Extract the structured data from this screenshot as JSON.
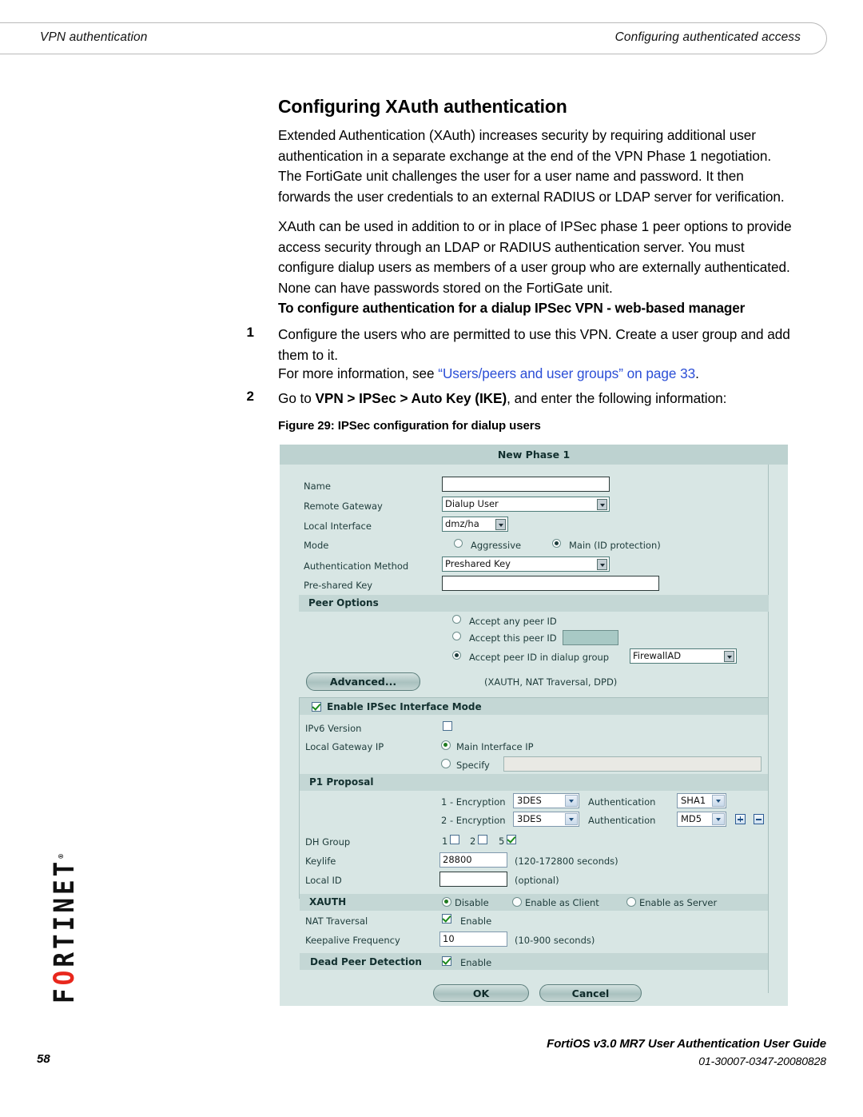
{
  "running_header": {
    "left": "VPN authentication",
    "right": "Configuring authenticated access"
  },
  "content": {
    "heading": "Configuring XAuth authentication",
    "paragraph_1": "Extended Authentication (XAuth) increases security by requiring additional user authentication in a separate exchange at the end of the VPN Phase 1 negotiation. The FortiGate unit challenges the user for a user name and password. It then forwards the user credentials to an external RADIUS or LDAP server for verification.",
    "paragraph_2": "XAuth can be used in addition to or in place of IPSec phase 1 peer options to provide access security through an LDAP or RADIUS authentication server. You must configure dialup users as members of a user group who are externally authenticated. None can have passwords stored on the FortiGate unit.",
    "subheading": "To configure authentication for a dialup IPSec VPN - web-based manager",
    "step_1_number": "1",
    "step_1_text": "Configure the users who are permitted to use this VPN. Create a user group and add them to it.",
    "crossref_prefix": "For more information, see ",
    "crossref_link": "“Users/peers and user groups” on page 33",
    "crossref_suffix": ".",
    "step_2_number": "2",
    "step_2_prefix": "Go to ",
    "step_2_bold": "VPN > IPSec > Auto Key (IKE)",
    "step_2_suffix": ", and enter the following information:",
    "figure_caption": "Figure 29: IPSec configuration for dialup users",
    "link_color": "#2b4ed6"
  },
  "figure": {
    "title": "New Phase 1",
    "fields": {
      "name_label": "Name",
      "name_value": "",
      "remote_gateway_label": "Remote Gateway",
      "remote_gateway_value": "Dialup User",
      "local_interface_label": "Local Interface",
      "local_interface_value": "dmz/ha",
      "mode_label": "Mode",
      "mode_option_aggressive": "Aggressive",
      "mode_option_main": "Main (ID protection)",
      "auth_method_label": "Authentication Method",
      "auth_method_value": "Preshared Key",
      "preshared_key_label": "Pre-shared Key",
      "preshared_key_value": ""
    },
    "peer_options": {
      "section_title": "Peer Options",
      "accept_any": "Accept any peer ID",
      "accept_this": "Accept this peer ID",
      "accept_this_value": "",
      "accept_group": "Accept peer ID in dialup group",
      "accept_group_value": "FirewallAD"
    },
    "advanced": {
      "button_label": "Advanced...",
      "hint": "(XAUTH, NAT Traversal, DPD)"
    },
    "interface_mode": {
      "enable_label": "Enable IPSec Interface Mode",
      "ipv6_label": "IPv6 Version",
      "local_gateway_label": "Local Gateway IP",
      "main_interface_ip": "Main Interface IP",
      "specify": "Specify",
      "specify_value": ""
    },
    "p1_proposal": {
      "section_title": "P1 Proposal",
      "rows": [
        {
          "encryption_label": "1 - Encryption",
          "encryption_value": "3DES",
          "authentication_label": "Authentication",
          "authentication_value": "SHA1"
        },
        {
          "encryption_label": "2 - Encryption",
          "encryption_value": "3DES",
          "authentication_label": "Authentication",
          "authentication_value": "MD5"
        }
      ],
      "dh_group_label": "DH Group",
      "dh_1": "1",
      "dh_2": "2",
      "dh_5": "5",
      "keylife_label": "Keylife",
      "keylife_value": "28800",
      "keylife_hint": "(120-172800 seconds)",
      "local_id_label": "Local ID",
      "local_id_value": "",
      "local_id_hint": "(optional)"
    },
    "xauth": {
      "section_title": "XAUTH",
      "disable": "Disable",
      "enable_client": "Enable as Client",
      "enable_server": "Enable as Server",
      "nat_traversal_label": "NAT Traversal",
      "nat_traversal_enable": "Enable",
      "keepalive_label": "Keepalive Frequency",
      "keepalive_value": "10",
      "keepalive_hint": "(10-900 seconds)",
      "dpd_label": "Dead Peer Detection",
      "dpd_enable": "Enable"
    },
    "buttons": {
      "ok": "OK",
      "cancel": "Cancel"
    }
  },
  "footer": {
    "page_number": "58",
    "guide_title": "FortiOS v3.0 MR7 User Authentication User Guide",
    "doc_id": "01-30007-0347-20080828"
  },
  "logo": {
    "text_left": "F",
    "text_o": "O",
    "text_right": "RTINET",
    "registered": "®"
  }
}
